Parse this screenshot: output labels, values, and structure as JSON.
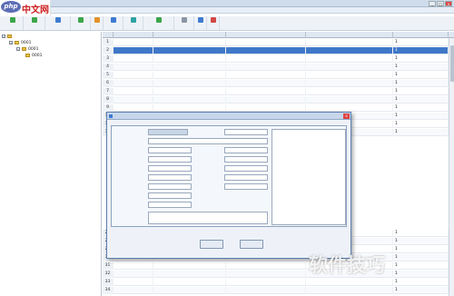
{
  "logo": {
    "mark": "php",
    "text": "中文网"
  },
  "window": {
    "title": "",
    "buttons": [
      "_",
      "□",
      "×"
    ]
  },
  "menubar": {
    "items": [
      "",
      "",
      "",
      "",
      "",
      "",
      "",
      ""
    ]
  },
  "toolbar": {
    "items": [
      {
        "label": "",
        "icon": "tree-icon"
      },
      {
        "label": "",
        "icon": "tree-icon"
      },
      {
        "label": "",
        "icon": "list-icon"
      },
      {
        "label": "",
        "icon": "add-icon"
      },
      {
        "label": "",
        "icon": "edit-icon"
      },
      {
        "label": "",
        "icon": "document-icon"
      },
      {
        "label": "",
        "icon": "copy-icon"
      },
      {
        "label": "",
        "icon": "import-icon"
      },
      {
        "label": "",
        "icon": "print-icon"
      },
      {
        "label": "",
        "icon": "save-icon"
      },
      {
        "label": "",
        "icon": "exit-icon"
      }
    ]
  },
  "tree": {
    "root": "",
    "nodes": [
      {
        "label": "0001",
        "level": 1
      },
      {
        "label": "0001",
        "level": 2
      },
      {
        "label": "0001",
        "level": 3
      }
    ]
  },
  "grid": {
    "columns": [
      "",
      "",
      "",
      "",
      "",
      ""
    ],
    "rows": [
      {
        "n": "1",
        "a": "",
        "b": "",
        "c": "",
        "d": "",
        "e": "1"
      },
      {
        "n": "2",
        "a": "",
        "b": "",
        "c": "",
        "d": "",
        "e": "1"
      },
      {
        "n": "3",
        "a": "",
        "b": "",
        "c": "",
        "d": "",
        "e": "1"
      },
      {
        "n": "4",
        "a": "",
        "b": "",
        "c": "",
        "d": "",
        "e": "1"
      },
      {
        "n": "5",
        "a": "",
        "b": "",
        "c": "",
        "d": "",
        "e": "1"
      },
      {
        "n": "6",
        "a": "",
        "b": "",
        "c": "",
        "d": "",
        "e": "1"
      },
      {
        "n": "7",
        "a": "",
        "b": "",
        "c": "",
        "d": "",
        "e": "1"
      },
      {
        "n": "8",
        "a": "",
        "b": "",
        "c": "",
        "d": "",
        "e": "1"
      },
      {
        "n": "9",
        "a": "",
        "b": "",
        "c": "",
        "d": "",
        "e": "1"
      },
      {
        "n": "10",
        "a": "",
        "b": "",
        "c": "",
        "d": "",
        "e": "1"
      },
      {
        "n": "11",
        "a": "",
        "b": "",
        "c": "",
        "d": "",
        "e": "1"
      },
      {
        "n": "12",
        "a": "",
        "b": "",
        "c": "",
        "d": "",
        "e": "1"
      }
    ],
    "lower_rows": [
      {
        "n": "27",
        "a": "",
        "b": "",
        "c": "",
        "d": "",
        "e": "1"
      },
      {
        "n": "28",
        "a": "",
        "b": "",
        "c": "",
        "d": "",
        "e": "1"
      },
      {
        "n": "29",
        "a": "",
        "b": "",
        "c": "",
        "d": "",
        "e": "1"
      },
      {
        "n": "30",
        "a": "",
        "b": "",
        "c": "",
        "d": "",
        "e": "1"
      },
      {
        "n": "31",
        "a": "",
        "b": "",
        "c": "",
        "d": "",
        "e": "1"
      },
      {
        "n": "32",
        "a": "",
        "b": "",
        "c": "",
        "d": "",
        "e": "1"
      },
      {
        "n": "33",
        "a": "",
        "b": "",
        "c": "",
        "d": "",
        "e": "1"
      },
      {
        "n": "34",
        "a": "",
        "b": "",
        "c": "",
        "d": "",
        "e": "1"
      }
    ],
    "selected_row": "2"
  },
  "dialog": {
    "title": "",
    "top_hint": "",
    "bottom_hint": "",
    "fields": [
      {
        "label": "",
        "value": ""
      },
      {
        "label": "",
        "value": ""
      },
      {
        "label": "",
        "value": ""
      },
      {
        "label": "",
        "value": ""
      },
      {
        "label": "",
        "value": ""
      },
      {
        "label": "",
        "value": ""
      },
      {
        "label": "",
        "value": ""
      },
      {
        "label": "",
        "value": ""
      },
      {
        "label": "",
        "value": ""
      },
      {
        "label": "",
        "value": ""
      },
      {
        "label": "",
        "value": ""
      },
      {
        "label": "",
        "value": ""
      },
      {
        "label": "",
        "value": ""
      },
      {
        "label": "",
        "value": ""
      },
      {
        "label": "",
        "value": ""
      },
      {
        "label": "",
        "value": ""
      }
    ],
    "ok_label": "",
    "cancel_label": ""
  },
  "watermark": "软件技巧",
  "colors": {
    "selection": "#3f78c8",
    "required_label": "#cc2222",
    "title_bar": "#cfdcec"
  }
}
